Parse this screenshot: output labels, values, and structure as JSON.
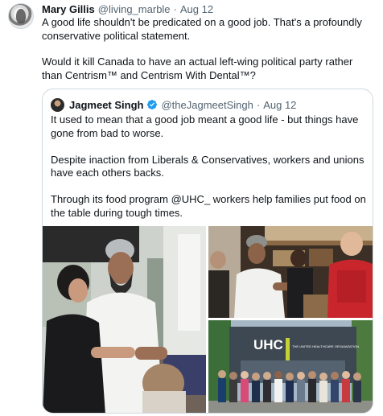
{
  "post": {
    "author_name": "Mary Gillis",
    "author_handle": "@living_marble",
    "separator": "·",
    "date": "Aug 12",
    "paragraphs": [
      "A good life shouldn't be predicated on a good job. That's a profoundly conservative political statement.",
      "Would it kill Canada to have an actual left-wing political party rather than Centrism™ and Centrism With Dental™?"
    ]
  },
  "quoted": {
    "author_name": "Jagmeet Singh",
    "author_handle": "@theJagmeetSingh",
    "separator": "·",
    "date": "Aug 12",
    "paragraphs": [
      "It used to mean that a good job meant a good life - but things have gone from bad to worse.",
      "Despite inaction from Liberals & Conservatives, workers and unions have each others backs.",
      "Through its food program @UHC_ workers help families put food on the table during tough times."
    ],
    "photos": {
      "sign_text": "UHC",
      "sign_subtext": "THE UNITED HEALTHCARE ORGANIZATION"
    }
  },
  "colors": {
    "text": "#0f1419",
    "muted": "#536471",
    "border": "#cfd9de",
    "verified_blue": "#1d9bf0"
  },
  "icons": [
    "verified-badge-icon"
  ]
}
